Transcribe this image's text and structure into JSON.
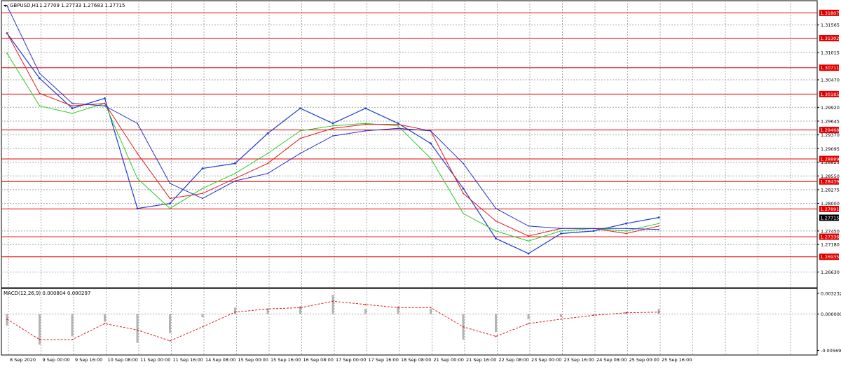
{
  "window": {
    "symbol_title": "GBPUSD,H1",
    "ohlc_text": "1.27709 1.27733 1.27683 1.27715",
    "macd_title": "MACD(12,26,9) 0.000804 0.000297"
  },
  "colors": {
    "background": "#ffffff",
    "grid": "#a9a9a9",
    "price": "#1b3fcf",
    "ma_fast": "#2bcc2b",
    "ma_mid": "#e01b1b",
    "ma_slow": "#2433c9",
    "level_line": "#e00000",
    "level_label_bg": "#e00000",
    "current_label_bg": "#000000",
    "macd_hist": "#b4b4b4",
    "macd_signal": "#e01b1b"
  },
  "chart_data": [
    {
      "type": "line",
      "title": "GBPUSD,H1",
      "x": [
        "8 Sep 2020",
        "9 Sep 00:00",
        "9 Sep 16:00",
        "10 Sep 08:00",
        "11 Sep 00:00",
        "11 Sep 16:00",
        "14 Sep 08:00",
        "15 Sep 00:00",
        "15 Sep 16:00",
        "16 Sep 08:00",
        "17 Sep 00:00",
        "17 Sep 16:00",
        "18 Sep 08:00",
        "21 Sep 00:00",
        "21 Sep 16:00",
        "22 Sep 08:00",
        "23 Sep 00:00",
        "23 Sep 16:00",
        "24 Sep 08:00",
        "25 Sep 00:00",
        "25 Sep 16:00"
      ],
      "series": [
        {
          "values": [
            1.314,
            1.305,
            1.299,
            1.301,
            1.279,
            1.28,
            1.287,
            1.288,
            1.294,
            1.299,
            1.296,
            1.299,
            1.296,
            1.292,
            1.283,
            1.273,
            1.27,
            1.274,
            1.2745,
            1.276,
            1.2772
          ]
        },
        {
          "values": [
            1.31,
            1.2995,
            1.298,
            1.3,
            1.285,
            1.279,
            1.283,
            1.286,
            1.29,
            1.2945,
            1.2955,
            1.296,
            1.2955,
            1.289,
            1.278,
            1.2745,
            1.2725,
            1.2745,
            1.275,
            1.2745,
            1.276
          ]
        },
        {
          "values": [
            1.314,
            1.302,
            1.2995,
            1.3,
            1.29,
            1.281,
            1.282,
            1.285,
            1.288,
            1.293,
            1.295,
            1.2958,
            1.2958,
            1.2945,
            1.282,
            1.2765,
            1.2735,
            1.275,
            1.275,
            1.274,
            1.2755
          ]
        },
        {
          "values": [
            1.3195,
            1.306,
            1.3,
            1.2995,
            1.296,
            1.284,
            1.281,
            1.2845,
            1.286,
            1.29,
            1.2935,
            1.2945,
            1.295,
            1.2945,
            1.288,
            1.279,
            1.2755,
            1.275,
            1.275,
            1.275,
            1.2748
          ]
        }
      ],
      "ylim": [
        1.2633,
        1.3205
      ],
      "y_ticks": [
        "1.31565",
        "1.31015",
        "1.30470",
        "1.29920",
        "1.29645",
        "1.29370",
        "1.29095",
        "1.28825",
        "1.28550",
        "1.28275",
        "1.28000",
        "1.27450",
        "1.27180",
        "1.26630"
      ],
      "levels": [
        {
          "value": 1.31807,
          "label": "1.31807"
        },
        {
          "value": 1.31302,
          "label": "1.31302"
        },
        {
          "value": 1.30711,
          "label": "1.30711"
        },
        {
          "value": 1.30185,
          "label": "1.30185"
        },
        {
          "value": 1.29468,
          "label": "1.29468"
        },
        {
          "value": 1.28889,
          "label": "1.28889"
        },
        {
          "value": 1.28439,
          "label": "1.28439"
        },
        {
          "value": 1.27891,
          "label": "1.27891"
        },
        {
          "value": 1.27336,
          "label": "1.27336"
        },
        {
          "value": 1.26935,
          "label": "1.26935"
        }
      ],
      "current_price": {
        "value": 1.27715,
        "label": "1.27715"
      },
      "grid": true
    },
    {
      "type": "bar",
      "title": "MACD(12,26,9) 0.000804 0.000297",
      "x": [
        "8 Sep 2020",
        "9 Sep 00:00",
        "9 Sep 16:00",
        "10 Sep 08:00",
        "11 Sep 00:00",
        "11 Sep 16:00",
        "14 Sep 08:00",
        "15 Sep 00:00",
        "15 Sep 16:00",
        "16 Sep 08:00",
        "17 Sep 00:00",
        "17 Sep 16:00",
        "18 Sep 08:00",
        "21 Sep 00:00",
        "21 Sep 16:00",
        "22 Sep 08:00",
        "23 Sep 00:00",
        "23 Sep 16:00",
        "24 Sep 08:00",
        "25 Sep 00:00",
        "25 Sep 16:00"
      ],
      "series": [
        {
          "values": [
            -0.0018,
            -0.0048,
            -0.0035,
            -0.0012,
            -0.0045,
            -0.003,
            -0.0005,
            0.001,
            0.0008,
            0.0012,
            0.003,
            0.0008,
            0.0012,
            0.0008,
            -0.004,
            -0.0028,
            -0.0008,
            -0.0005,
            0.0,
            0.0003,
            0.0008
          ]
        },
        {
          "values": [
            -0.0008,
            -0.004,
            -0.004,
            -0.0015,
            -0.0025,
            -0.0042,
            -0.002,
            0.0003,
            0.0008,
            0.001,
            0.002,
            0.0015,
            0.001,
            0.001,
            -0.002,
            -0.0035,
            -0.0015,
            -0.0008,
            -0.0002,
            0.0002,
            0.0003
          ]
        }
      ],
      "ylim": [
        -0.0063,
        0.004
      ],
      "y_ticks": [
        "0.003232",
        "0.000000",
        "-0.005693"
      ]
    }
  ]
}
